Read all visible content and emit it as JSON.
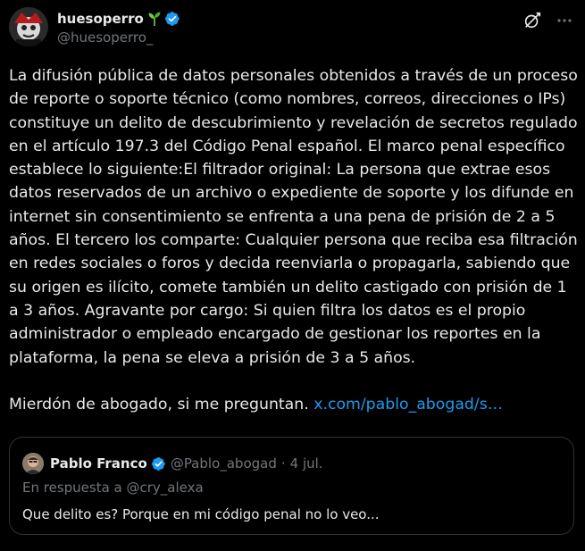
{
  "author": {
    "display_name": "huesoperro",
    "handle": "@huesoperro_",
    "badge_icon": "sprout-icon",
    "verified_icon": "verified-badge-icon",
    "verified_color": "#1d9bf0"
  },
  "header_actions": {
    "grok_icon": "grok-icon",
    "more_icon": "more-options-icon"
  },
  "post": {
    "text_main": "La difusión pública de datos personales obtenidos a través de un proceso de reporte o soporte técnico (como nombres, correos, direcciones o IPs) constituye un delito de descubrimiento y revelación de secretos regulado en el artículo 197.3 del Código Penal español. El marco penal específico establece lo siguiente:El filtrador original: La persona que extrae esos datos reservados de un archivo o expediente de soporte y los difunde en internet sin consentimiento se enfrenta a una pena de prisión de 2 a 5 años. El tercero los comparte: Cualquier persona que reciba esa filtración en redes sociales o foros y decida reenviarla o propagarla, sabiendo que su origen es ilícito, comete también un delito castigado con prisión de 1 a 3 años. Agravante por cargo: Si quien filtra los datos es el propio administrador o empleado encargado de gestionar los reportes en la plataforma, la pena se eleva a prisión de 3 a 5 años.",
    "text_tail": "Mierdón de abogado, si me preguntan.",
    "link_text": "x.com/pablo_abogad/s…",
    "link_color": "#1d9bf0"
  },
  "quoted": {
    "display_name": "Pablo Franco",
    "handle": "@Pablo_abogad",
    "separator": "·",
    "date": "4 jul.",
    "reply_context": "En respuesta a @cry_alexa",
    "text": "Que delito es? Porque en mi código penal no lo veo..."
  },
  "colors": {
    "background": "#000000",
    "text": "#e7e9ea",
    "muted": "#71767b",
    "border": "#2f3336"
  }
}
